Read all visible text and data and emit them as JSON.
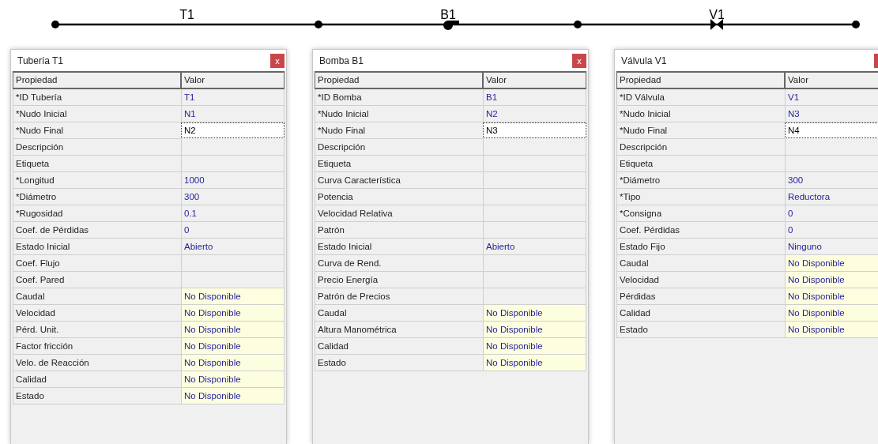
{
  "diagram": {
    "links": [
      {
        "label": "T1",
        "kind": "pipe"
      },
      {
        "label": "B1",
        "kind": "pump"
      },
      {
        "label": "V1",
        "kind": "valve"
      }
    ]
  },
  "panels": [
    {
      "title": "Tubería T1",
      "close": "x",
      "columns": [
        "Propiedad",
        "Valor"
      ],
      "rows": [
        {
          "property": "*ID Tubería",
          "value": "T1",
          "kind": "value"
        },
        {
          "property": "*Nudo Inicial",
          "value": "N1",
          "kind": "value"
        },
        {
          "property": "*Nudo Final",
          "value": "N2",
          "kind": "editing"
        },
        {
          "property": "Descripción",
          "kind": "empty"
        },
        {
          "property": "Etiqueta",
          "kind": "empty"
        },
        {
          "property": "*Longitud",
          "value": "1000",
          "kind": "value"
        },
        {
          "property": "*Diámetro",
          "value": "300",
          "kind": "value"
        },
        {
          "property": "*Rugosidad",
          "value": "0.1",
          "kind": "value"
        },
        {
          "property": "Coef. de Pérdidas",
          "value": "0",
          "kind": "value"
        },
        {
          "property": "Estado Inicial",
          "value": "Abierto",
          "kind": "value"
        },
        {
          "property": "Coef. Flujo",
          "kind": "empty"
        },
        {
          "property": "Coef. Pared",
          "kind": "empty"
        },
        {
          "property": "Caudal",
          "value": "No Disponible",
          "kind": "result"
        },
        {
          "property": "Velocidad",
          "value": "No Disponible",
          "kind": "result"
        },
        {
          "property": "Pérd. Unit.",
          "value": "No Disponible",
          "kind": "result"
        },
        {
          "property": "Factor fricción",
          "value": "No Disponible",
          "kind": "result"
        },
        {
          "property": "Velo. de Reacción",
          "value": "No Disponible",
          "kind": "result"
        },
        {
          "property": "Calidad",
          "value": "No Disponible",
          "kind": "result"
        },
        {
          "property": "Estado",
          "value": "No Disponible",
          "kind": "result"
        }
      ]
    },
    {
      "title": "Bomba B1",
      "close": "x",
      "columns": [
        "Propiedad",
        "Valor"
      ],
      "rows": [
        {
          "property": "*ID Bomba",
          "value": "B1",
          "kind": "value"
        },
        {
          "property": "*Nudo Inicial",
          "value": "N2",
          "kind": "value"
        },
        {
          "property": "*Nudo Final",
          "value": "N3",
          "kind": "editing"
        },
        {
          "property": "Descripción",
          "kind": "empty"
        },
        {
          "property": "Etiqueta",
          "kind": "empty"
        },
        {
          "property": "Curva Característica",
          "kind": "empty"
        },
        {
          "property": "Potencia",
          "kind": "empty"
        },
        {
          "property": "Velocidad Relativa",
          "kind": "empty"
        },
        {
          "property": "Patrón",
          "kind": "empty"
        },
        {
          "property": "Estado Inicial",
          "value": "Abierto",
          "kind": "value"
        },
        {
          "property": "Curva de Rend.",
          "kind": "empty"
        },
        {
          "property": "Precio Energía",
          "kind": "empty"
        },
        {
          "property": "Patrón de Precios",
          "kind": "empty"
        },
        {
          "property": "Caudal",
          "value": "No Disponible",
          "kind": "result"
        },
        {
          "property": "Altura Manométrica",
          "value": "No Disponible",
          "kind": "result"
        },
        {
          "property": "Calidad",
          "value": "No Disponible",
          "kind": "result"
        },
        {
          "property": "Estado",
          "value": "No Disponible",
          "kind": "result"
        }
      ]
    },
    {
      "title": "Válvula V1",
      "columns": [
        "Propiedad",
        "Valor"
      ],
      "rows": [
        {
          "property": "*ID Válvula",
          "value": "V1",
          "kind": "value"
        },
        {
          "property": "*Nudo Inicial",
          "value": "N3",
          "kind": "value"
        },
        {
          "property": "*Nudo Final",
          "value": "N4",
          "kind": "editing"
        },
        {
          "property": "Descripción",
          "kind": "empty"
        },
        {
          "property": "Etiqueta",
          "kind": "empty"
        },
        {
          "property": "*Diámetro",
          "value": "300",
          "kind": "value"
        },
        {
          "property": "*Tipo",
          "value": "Reductora",
          "kind": "value"
        },
        {
          "property": "*Consigna",
          "value": "0",
          "kind": "value"
        },
        {
          "property": "Coef. Pérdidas",
          "value": "0",
          "kind": "value"
        },
        {
          "property": "Estado Fijo",
          "value": "Ninguno",
          "kind": "value"
        },
        {
          "property": "Caudal",
          "value": "No Disponible",
          "kind": "result"
        },
        {
          "property": "Velocidad",
          "value": "No Disponible",
          "kind": "result"
        },
        {
          "property": "Pérdidas",
          "value": "No Disponible",
          "kind": "result"
        },
        {
          "property": "Calidad",
          "value": "No Disponible",
          "kind": "result"
        },
        {
          "property": "Estado",
          "value": "No Disponible",
          "kind": "result"
        }
      ]
    }
  ]
}
